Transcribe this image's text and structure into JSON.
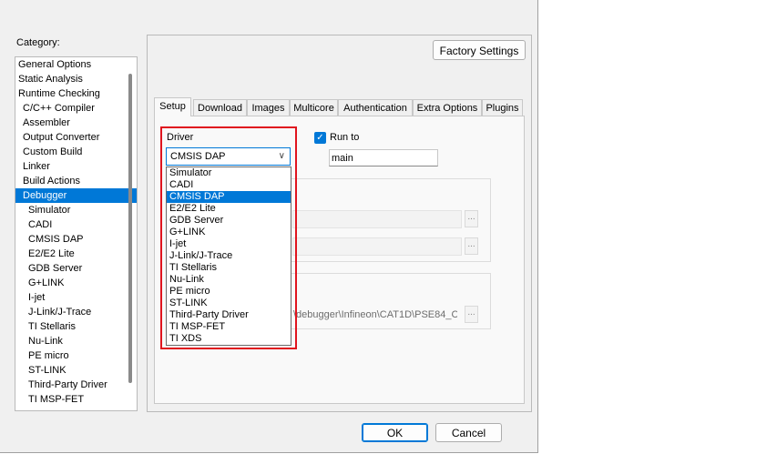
{
  "category": {
    "label": "Category:",
    "items": [
      {
        "label": "General Options",
        "level": 0
      },
      {
        "label": "Static Analysis",
        "level": 0
      },
      {
        "label": "Runtime Checking",
        "level": 0
      },
      {
        "label": "C/C++ Compiler",
        "level": 1
      },
      {
        "label": "Assembler",
        "level": 1
      },
      {
        "label": "Output Converter",
        "level": 1
      },
      {
        "label": "Custom Build",
        "level": 1
      },
      {
        "label": "Linker",
        "level": 1
      },
      {
        "label": "Build Actions",
        "level": 1
      },
      {
        "label": "Debugger",
        "level": 1,
        "selected": true
      },
      {
        "label": "Simulator",
        "level": 2
      },
      {
        "label": "CADI",
        "level": 2
      },
      {
        "label": "CMSIS DAP",
        "level": 2
      },
      {
        "label": "E2/E2 Lite",
        "level": 2
      },
      {
        "label": "GDB Server",
        "level": 2
      },
      {
        "label": "G+LINK",
        "level": 2
      },
      {
        "label": "I-jet",
        "level": 2
      },
      {
        "label": "J-Link/J-Trace",
        "level": 2
      },
      {
        "label": "TI Stellaris",
        "level": 2
      },
      {
        "label": "Nu-Link",
        "level": 2
      },
      {
        "label": "PE micro",
        "level": 2
      },
      {
        "label": "ST-LINK",
        "level": 2
      },
      {
        "label": "Third-Party Driver",
        "level": 2
      },
      {
        "label": "TI MSP-FET",
        "level": 2
      }
    ]
  },
  "factory_settings_label": "Factory Settings",
  "tabs": [
    {
      "label": "Setup",
      "active": true
    },
    {
      "label": "Download"
    },
    {
      "label": "Images"
    },
    {
      "label": "Multicore"
    },
    {
      "label": "Authentication"
    },
    {
      "label": "Extra Options"
    },
    {
      "label": "Plugins"
    }
  ],
  "setup": {
    "driver_label": "Driver",
    "driver_value": "CMSIS DAP",
    "driver_options": [
      "Simulator",
      "CADI",
      "CMSIS DAP",
      "E2/E2 Lite",
      "GDB Server",
      "G+LINK",
      "I-jet",
      "J-Link/J-Trace",
      "TI Stellaris",
      "Nu-Link",
      "PE micro",
      "ST-LINK",
      "Third-Party Driver",
      "TI MSP-FET",
      "TI XDS"
    ],
    "driver_selected": "CMSIS DAP",
    "run_to_label": "Run to",
    "run_to_checked": true,
    "run_to_value": "main",
    "device_path": "\\debugger\\Infineon\\CAT1D\\PSE84_C",
    "browse_label": "..."
  },
  "ok_label": "OK",
  "cancel_label": "Cancel",
  "colors": {
    "accent": "#0078d7",
    "highlight_border": "#e0141e"
  }
}
